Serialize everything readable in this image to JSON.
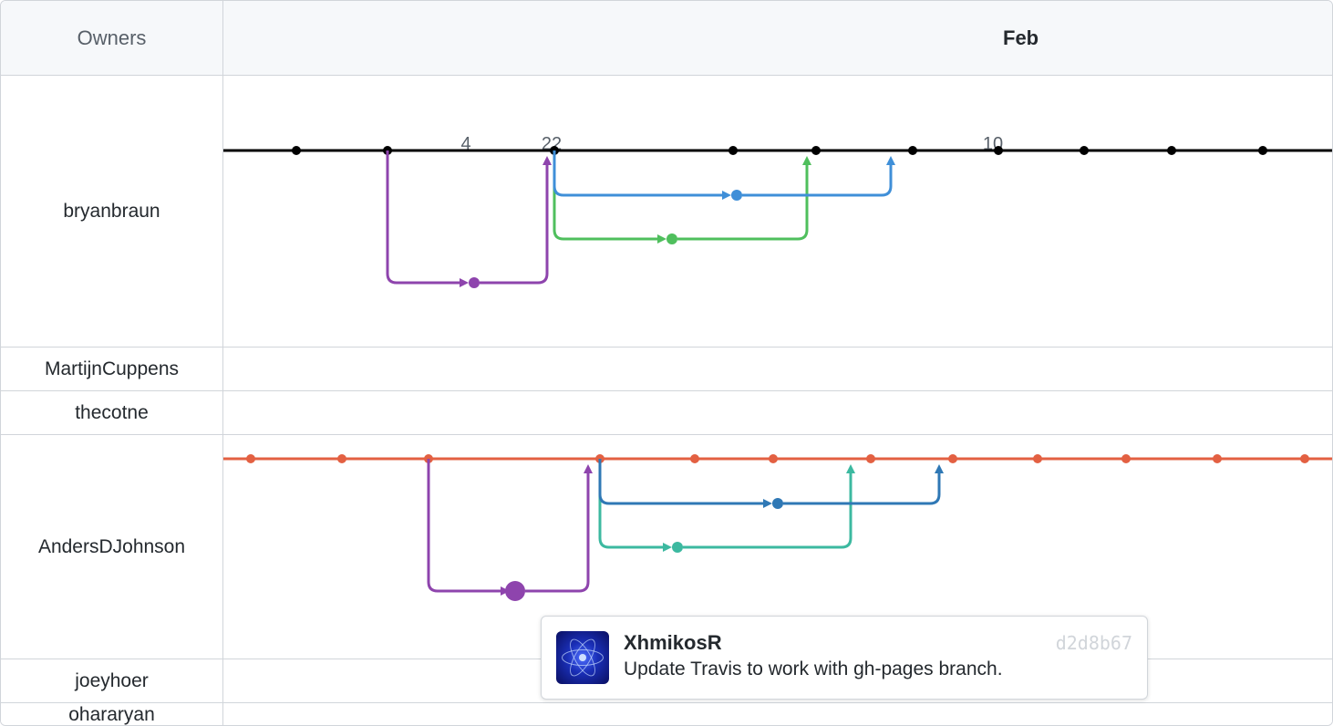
{
  "header": {
    "owners_label": "Owners",
    "month": "Feb"
  },
  "ticks": [
    "4",
    "22",
    "10"
  ],
  "owners": {
    "bryanbraun": "bryanbraun",
    "martijn": "MartijnCuppens",
    "thecotne": "thecotne",
    "anders": "AndersDJohnson",
    "joeyhoer": "joeyhoer",
    "ohararyan": "ohararyan"
  },
  "tooltip": {
    "author": "XhmikosR",
    "hash": "d2d8b67",
    "message": "Update Travis to work with gh-pages branch."
  },
  "colors": {
    "main1": "#000000",
    "main2": "#e36042",
    "purple": "#8e44ad",
    "green": "#4fbf5d",
    "teal": "#3cb9a0",
    "blue": "#3f8fd8",
    "blue2": "#2f78b5"
  },
  "graphs": {
    "bryanbraun": {
      "mainColor": "#000000",
      "mainDots": [
        80,
        180,
        363,
        559,
        650,
        756,
        850,
        944,
        1040,
        1140,
        1234
      ],
      "branches": [
        {
          "color": "#8e44ad",
          "startX": 180,
          "dropY": 145,
          "midX": 275,
          "endX": 355,
          "arrowEnd": true
        },
        {
          "color": "#4fbf5d",
          "startX": 363,
          "dropY": 97,
          "midX": 492,
          "endX": 640,
          "arrowEnd": true
        },
        {
          "color": "#3f8fd8",
          "startX": 363,
          "dropY": 49,
          "midX": 563,
          "endX": 732,
          "arrowEnd": true
        }
      ]
    },
    "anders": {
      "mainColor": "#e36042",
      "mainDots": [
        30,
        130,
        225,
        413,
        517,
        603,
        710,
        800,
        893,
        990,
        1090,
        1186
      ],
      "branches": [
        {
          "color": "#8e44ad",
          "startX": 225,
          "dropY": 145,
          "midX": 320,
          "midLarge": true,
          "endX": 400,
          "arrowEnd": true
        },
        {
          "color": "#3cb9a0",
          "startX": 413,
          "dropY": 97,
          "midX": 498,
          "endX": 688,
          "arrowEnd": true
        },
        {
          "color": "#2f78b5",
          "startX": 413,
          "dropY": 49,
          "midX": 608,
          "endX": 785,
          "arrowEnd": true
        }
      ]
    }
  }
}
